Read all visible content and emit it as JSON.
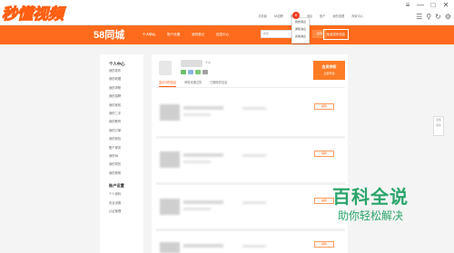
{
  "watermark": {
    "text": "秒懂视频"
  },
  "topbar": {
    "links": [
      "手机版",
      "58招聘",
      "我的58",
      "消息",
      "账户",
      "我的收藏",
      "商家中心"
    ],
    "window_controls": [
      "≡",
      "—",
      "□",
      "✕"
    ],
    "browser_tools": [
      "☰",
      "⚲",
      "↻",
      "⚙"
    ]
  },
  "header": {
    "logo": "58同城",
    "nav": [
      "个人中心",
      "账户设置",
      "我的登记",
      "信息中心"
    ],
    "search_placeholder": "搜索",
    "search_button": "搜索",
    "publish_button": "免费发布信息",
    "message_count": "8"
  },
  "dropdown": {
    "items": [
      "我的消息",
      "通知消息",
      "系统消息"
    ]
  },
  "sidebar": {
    "title": "个人中心",
    "items": [
      "我的发布",
      "我的收藏",
      "我的求职",
      "我的招聘",
      "我的家政",
      "我的二手",
      "我的教育",
      "我的订单",
      "我的钱包",
      "账户服务",
      "我的58",
      "我的简历",
      "我的帮帮"
    ],
    "section": "账户设置",
    "section_items": [
      "个人资料",
      "安全设置",
      "认证管理"
    ]
  },
  "profile": {
    "tag": "个人",
    "icon_colors": [
      "#6bbf6a",
      "#8ab4e0",
      "#7fc97a",
      "#a0a0a0"
    ]
  },
  "promo": {
    "title": "会员特权",
    "sub": "立即开通"
  },
  "tabs": [
    "显示中的信息",
    "审核未通过的",
    "已删除的信息"
  ],
  "rows": [
    {
      "action": "编辑"
    },
    {
      "action": "编辑"
    },
    {
      "action": "编辑"
    },
    {
      "action": "编辑"
    }
  ],
  "right_panel": {
    "items": [
      "反馈",
      "建议"
    ]
  },
  "brand": {
    "title": "百科全说",
    "subtitle": "助你轻松解决"
  },
  "colors": {
    "brand_orange": "#ff6b1c",
    "brand_green": "#2aa56a"
  }
}
